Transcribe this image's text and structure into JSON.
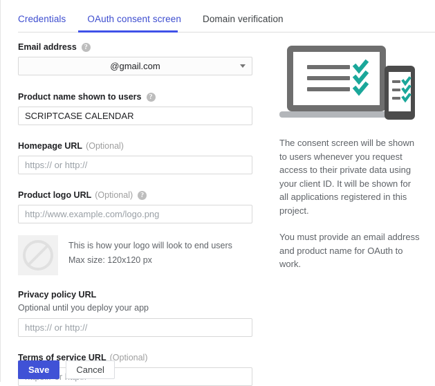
{
  "tabs": [
    {
      "label": "Credentials",
      "active": false,
      "style": "link"
    },
    {
      "label": "OAuth consent screen",
      "active": true,
      "style": "link"
    },
    {
      "label": "Domain verification",
      "active": false,
      "style": "plain"
    }
  ],
  "form": {
    "email": {
      "label": "Email address",
      "help_icon": "?",
      "value": "@gmail.com"
    },
    "product_name": {
      "label": "Product name shown to users",
      "help_icon": "?",
      "value": "SCRIPTCASE CALENDAR"
    },
    "homepage_url": {
      "label": "Homepage URL",
      "optional": "(Optional)",
      "value": "",
      "placeholder": "https:// or http://"
    },
    "product_logo_url": {
      "label": "Product logo URL",
      "optional": "(Optional)",
      "help_icon": "?",
      "value": "",
      "placeholder": "http://www.example.com/logo.png"
    },
    "logo_preview": {
      "line1": "This is how your logo will look to end users",
      "line2": "Max size: 120x120 px",
      "icon": "no-image-icon"
    },
    "privacy_policy_url": {
      "label": "Privacy policy URL",
      "sublabel": "Optional until you deploy your app",
      "value": "",
      "placeholder": "https:// or http://"
    },
    "terms_of_service_url": {
      "label": "Terms of service URL",
      "optional": "(Optional)",
      "value": "",
      "placeholder": "https:// or http://"
    }
  },
  "buttons": {
    "save": "Save",
    "cancel": "Cancel"
  },
  "sidebar_info": {
    "illustration": "laptop-and-phone-checklist-illustration",
    "paragraph1": "The consent screen will be shown to users whenever you request access to their private data using your client ID. It will be shown for all applications registered in this project.",
    "paragraph2": "You must provide an email address and product name for OAuth to work."
  },
  "colors": {
    "accent_blue": "#3f51e8",
    "save_button": "#4052d6",
    "tab_link": "#3c4ccf",
    "illustration_gray": "#6e6e6e",
    "illustration_teal": "#1aa79a",
    "help_icon_gray": "#bdbdbd",
    "text_secondary": "#5f6368",
    "input_border": "#d8d8d8"
  }
}
